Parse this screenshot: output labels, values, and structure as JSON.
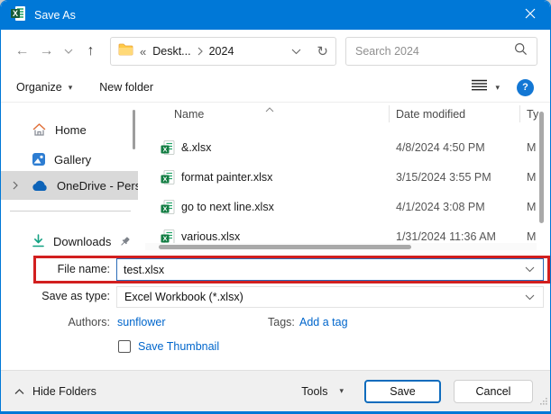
{
  "window": {
    "title": "Save As"
  },
  "nav": {
    "breadcrumb": {
      "overflow": "«",
      "folder1": "Deskt...",
      "folder2": "2024"
    },
    "search_placeholder": "Search 2024"
  },
  "icons": {
    "back": "←",
    "forward": "→",
    "up": "↑",
    "refresh": "↻",
    "help": "?",
    "menu_caret": "▾"
  },
  "toolbar": {
    "organize_label": "Organize",
    "new_folder_label": "New folder"
  },
  "sidebar": {
    "items": [
      {
        "label": "Home"
      },
      {
        "label": "Gallery"
      },
      {
        "label": "OneDrive - Perso"
      },
      {
        "label": "Downloads"
      }
    ]
  },
  "file_list": {
    "columns": {
      "name": "Name",
      "date": "Date modified",
      "type": "Ty"
    },
    "rows": [
      {
        "name": "&.xlsx",
        "date": "4/8/2024 4:50 PM",
        "type": "M"
      },
      {
        "name": "format painter.xlsx",
        "date": "3/15/2024 3:55 PM",
        "type": "M"
      },
      {
        "name": "go to next line.xlsx",
        "date": "4/1/2024 3:08 PM",
        "type": "M"
      },
      {
        "name": "various.xlsx",
        "date": "1/31/2024 11:36 AM",
        "type": "M"
      }
    ]
  },
  "fields": {
    "file_name_label": "File name:",
    "file_name_value": "test.xlsx",
    "save_as_type_label": "Save as type:",
    "save_as_type_value": "Excel Workbook (*.xlsx)",
    "authors_label": "Authors:",
    "authors_value": "sunflower",
    "tags_label": "Tags:",
    "tags_value": "Add a tag",
    "save_thumbnail_label": "Save Thumbnail"
  },
  "footer": {
    "hide_folders_label": "Hide Folders",
    "tools_label": "Tools",
    "save_label": "Save",
    "cancel_label": "Cancel"
  },
  "colors": {
    "titlebar": "#0078d7",
    "accent": "#0f6cbd",
    "link": "#0066cc",
    "annotation_red": "#d21f1f",
    "selected_item_bg": "#d9d9d9",
    "excel_green": "#217346"
  }
}
